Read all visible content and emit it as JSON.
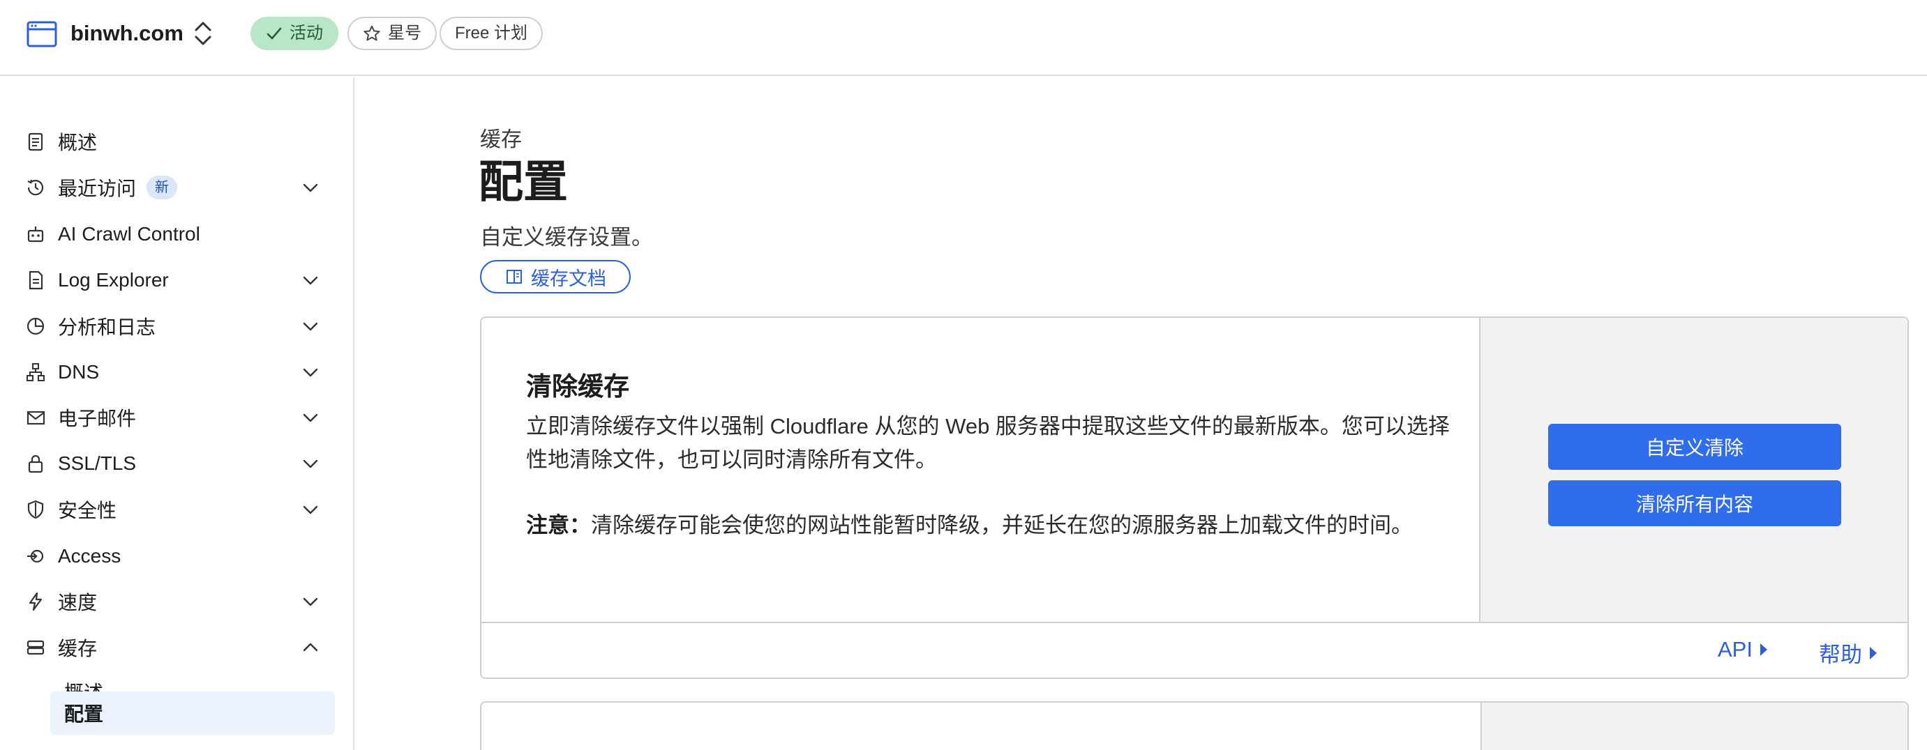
{
  "header": {
    "site_name": "binwh.com",
    "status_label": "活动",
    "star_label": "星号",
    "plan_label": "Free 计划"
  },
  "sidebar": {
    "items": [
      {
        "label": "概述",
        "icon": "clipboard-icon",
        "expandable": false
      },
      {
        "label": "最近访问",
        "icon": "history-icon",
        "expandable": true,
        "badge": "新"
      },
      {
        "label": "AI Crawl Control",
        "icon": "robot-icon",
        "expandable": false
      },
      {
        "label": "Log Explorer",
        "icon": "log-icon",
        "expandable": true
      },
      {
        "label": "分析和日志",
        "icon": "pie-chart-icon",
        "expandable": true
      },
      {
        "label": "DNS",
        "icon": "network-icon",
        "expandable": true
      },
      {
        "label": "电子邮件",
        "icon": "mail-icon",
        "expandable": true
      },
      {
        "label": "SSL/TLS",
        "icon": "lock-icon",
        "expandable": true
      },
      {
        "label": "安全性",
        "icon": "shield-icon",
        "expandable": true
      },
      {
        "label": "Access",
        "icon": "access-icon",
        "expandable": false
      },
      {
        "label": "速度",
        "icon": "lightning-icon",
        "expandable": true
      },
      {
        "label": "缓存",
        "icon": "cache-icon",
        "expandable": true,
        "expanded": true
      }
    ],
    "subitems": [
      {
        "label": "概述",
        "selected": false
      },
      {
        "label": "配置",
        "selected": true
      }
    ]
  },
  "main": {
    "breadcrumb": "缓存",
    "title": "配置",
    "subtitle": "自定义缓存设置。",
    "doc_button": "缓存文档",
    "purge_card": {
      "title": "清除缓存",
      "description": "立即清除缓存文件以强制 Cloudflare 从您的 Web 服务器中提取这些文件的最新版本。您可以选择性地清除文件，也可以同时清除所有文件。",
      "note_label": "注意：",
      "note_text": "清除缓存可能会使您的网站性能暂时降级，并延长在您的源服务器上加载文件的时间。",
      "custom_purge_button": "自定义清除",
      "purge_all_button": "清除所有内容",
      "api_link": "API",
      "help_link": "帮助"
    }
  },
  "colors": {
    "accent": "#2f6ded",
    "link": "#2c5fd8",
    "active_badge_bg": "#b9e6c6",
    "selected_nav_bg": "#edf3fe"
  }
}
